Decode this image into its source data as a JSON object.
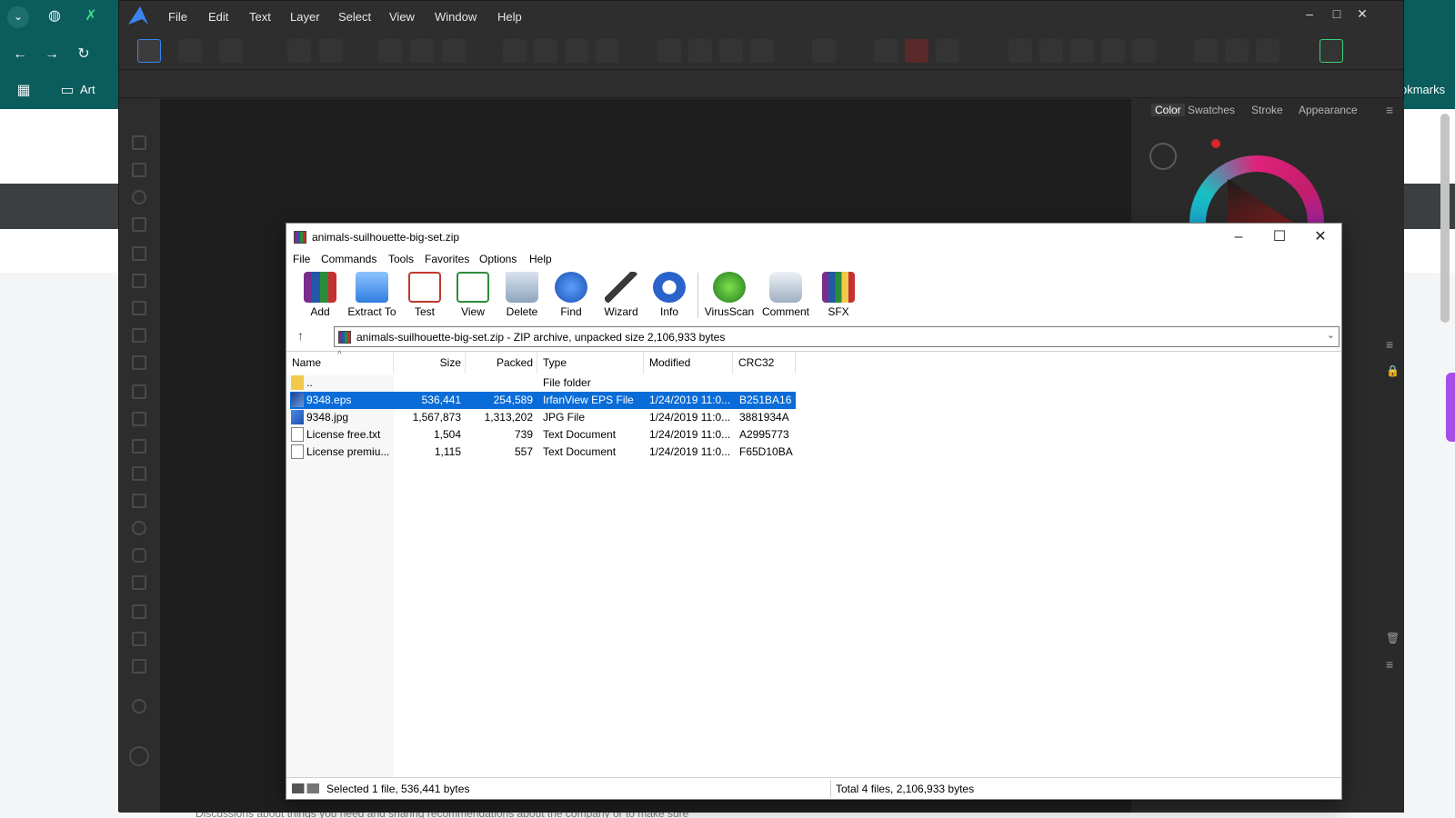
{
  "browser": {
    "bookmark_label": "Art",
    "bookmarks_label": "okmarks",
    "footer_text": "Discussions about things you need and sharing recommendations about the company or to make sure"
  },
  "affinity": {
    "menu": [
      "File",
      "Edit",
      "Text",
      "Layer",
      "Select",
      "View",
      "Window",
      "Help"
    ],
    "panel_tabs": [
      "Color",
      "Swatches",
      "Stroke",
      "Appearance"
    ],
    "active_tab": "Color",
    "accent_color": "#3a84f0"
  },
  "winrar": {
    "title": "animals-suilhouette-big-set.zip",
    "menu": [
      "File",
      "Commands",
      "Tools",
      "Favorites",
      "Options",
      "Help"
    ],
    "toolbar": [
      "Add",
      "Extract To",
      "Test",
      "View",
      "Delete",
      "Find",
      "Wizard",
      "Info",
      "VirusScan",
      "Comment",
      "SFX"
    ],
    "address": "animals-suilhouette-big-set.zip - ZIP archive, unpacked size 2,106,933 bytes",
    "columns": [
      "Name",
      "Size",
      "Packed",
      "Type",
      "Modified",
      "CRC32"
    ],
    "rows": [
      {
        "name": "..",
        "size": "",
        "packed": "",
        "type": "File folder",
        "modified": "",
        "crc": ""
      },
      {
        "name": "9348.eps",
        "size": "536,441",
        "packed": "254,589",
        "type": "IrfanView EPS File",
        "modified": "1/24/2019 11:0...",
        "crc": "B251BA16"
      },
      {
        "name": "9348.jpg",
        "size": "1,567,873",
        "packed": "1,313,202",
        "type": "JPG File",
        "modified": "1/24/2019 11:0...",
        "crc": "3881934A"
      },
      {
        "name": "License free.txt",
        "size": "1,504",
        "packed": "739",
        "type": "Text Document",
        "modified": "1/24/2019 11:0...",
        "crc": "A2995773"
      },
      {
        "name": "License premiu...",
        "size": "1,115",
        "packed": "557",
        "type": "Text Document",
        "modified": "1/24/2019 11:0...",
        "crc": "F65D10BA"
      }
    ],
    "selected_row": 1,
    "status_left": "Selected 1 file, 536,441 bytes",
    "status_right": "Total 4 files, 2,106,933 bytes",
    "selection_color": "#0a6cd8"
  }
}
